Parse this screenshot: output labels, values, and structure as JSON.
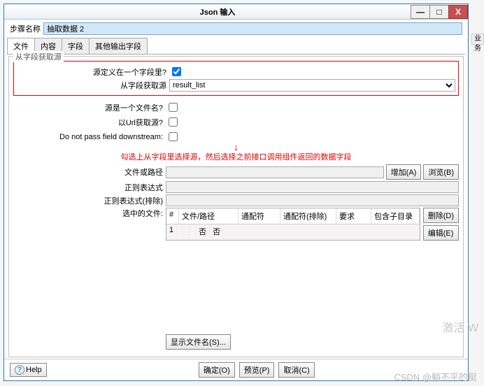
{
  "window": {
    "title": "Json 输入"
  },
  "winbtns": {
    "min": "—",
    "max": "□",
    "close": "X"
  },
  "step": {
    "label": "步骤名称",
    "value": "抽取数据 2"
  },
  "tabs": [
    "文件",
    "内容",
    "字段",
    "其他输出字段"
  ],
  "group": {
    "title": "从字段获取源"
  },
  "fields": {
    "source_defined_in_field": {
      "label": "源定义在一个字段里?",
      "checked": true
    },
    "get_source_from_field": {
      "label": "从字段获取源",
      "value": "result_list"
    },
    "is_filename": {
      "label": "源是一个文件名?",
      "checked": false
    },
    "get_from_url": {
      "label": "以Url获取源?",
      "checked": false
    },
    "no_pass_downstream": {
      "label": "Do not pass field downstream:",
      "checked": false
    },
    "file_or_path": {
      "label": "文件或路径",
      "placeholder": ""
    },
    "regex": {
      "label": "正则表达式",
      "placeholder": ""
    },
    "regex_exclude": {
      "label": "正则表达式(排除)",
      "placeholder": ""
    },
    "selected_files": {
      "label": "选中的文件:"
    }
  },
  "buttons": {
    "add": "增加(A)",
    "browse": "浏览(B)",
    "delete": "删除(D)",
    "edit": "编辑(E)",
    "show_files": "显示文件名(S)...",
    "ok": "确定(O)",
    "preview": "预览(P)",
    "cancel": "取消(C)",
    "help": "Help"
  },
  "annotation": {
    "text": "勾选上从字段里选择源，然后选择之前接口调用组件返回的数据字段"
  },
  "table": {
    "headers": [
      "#",
      "文件/路径",
      "通配符",
      "通配符(排除)",
      "要求",
      "包含子目录"
    ],
    "rows": [
      {
        "num": "1",
        "file": "",
        "wildcard": "",
        "wildcard_ex": "",
        "required": "否",
        "subdir": "否"
      }
    ]
  },
  "watermarks": {
    "w1": "激活 W",
    "w2": "CSDN @躺不平的挺"
  },
  "bg_extra": "业务"
}
